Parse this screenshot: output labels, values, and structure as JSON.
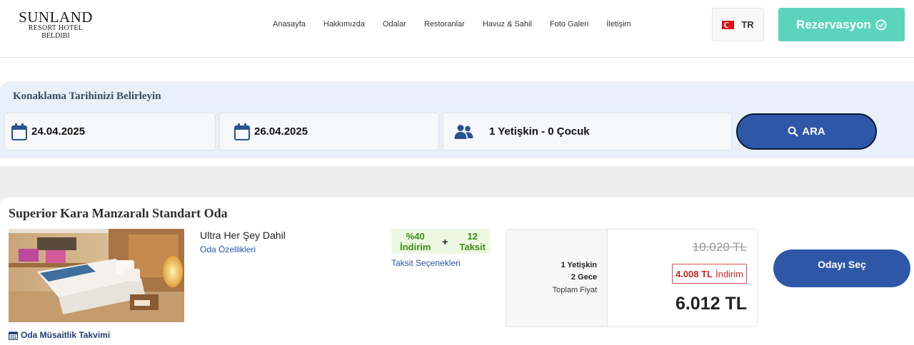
{
  "logo": {
    "line1": "SUNLAND",
    "line2": "RESORT HOTEL",
    "line3": "BELDIBI"
  },
  "nav": [
    "Anasayfa",
    "Hakkımızda",
    "Odalar",
    "Restoranlar",
    "Havuz & Sahil",
    "Foto Galeri",
    "İletişim"
  ],
  "language": {
    "code": "TR",
    "flag": "turkey-flag-icon"
  },
  "reservation_button": "Rezervasyon",
  "search": {
    "title": "Konaklama Tarihinizi Belirleyin",
    "checkin": "24.04.2025",
    "checkout": "26.04.2025",
    "guests": "1 Yetişkin - 0 Çocuk",
    "button": "ARA"
  },
  "room": {
    "title": "Superior Kara Manzaralı Standart Oda",
    "board": "Ultra Her Şey Dahil",
    "features_link": "Oda Özellikleri",
    "availability_link": "Oda Müsaitlik Takvimi",
    "promo": {
      "discount_top": "%40",
      "discount_bottom": "İndirim",
      "plus": "+",
      "installment_top": "12",
      "installment_bottom": "Taksit"
    },
    "installment_link": "Taksit Seçenekleri",
    "price": {
      "adults": "1 Yetişkin",
      "nights": "2 Gece",
      "total_label": "Toplam Fiyat",
      "old_price": "10.020 TL",
      "discount_amount": "4.008 TL",
      "discount_label": "İndirim",
      "total": "6.012 TL"
    },
    "select_button": "Odayı Seç"
  },
  "colors": {
    "brand_blue": "#2f57a8",
    "mint": "#5ad4bd",
    "green": "#3a8d14",
    "red": "#d92525"
  }
}
